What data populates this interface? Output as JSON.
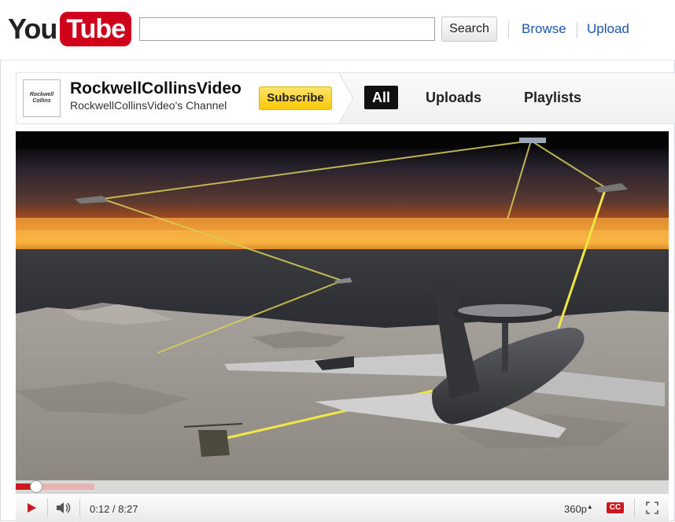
{
  "header": {
    "logo_you": "You",
    "logo_tube": "Tube",
    "search_value": "",
    "search_button": "Search",
    "nav": [
      "Browse",
      "Upload"
    ]
  },
  "channel": {
    "avatar_text": "Rockwell Collins",
    "name": "RockwellCollinsVideo",
    "subtitle": "RockwellCollinsVideo's Channel",
    "subscribe_label": "Subscribe",
    "tabs": [
      {
        "label": "All",
        "active": true
      },
      {
        "label": "Uploads",
        "active": false
      },
      {
        "label": "Playlists",
        "active": false
      }
    ]
  },
  "player": {
    "current_time": "0:12",
    "separator": " / ",
    "duration": "8:27",
    "time_display": "0:12 / 8:27",
    "progress_fraction": 0.024,
    "quality": "360p",
    "cc_label": "CC",
    "icons": [
      "play-icon",
      "volume-icon",
      "quality-arrow-icon",
      "cc-icon",
      "fullscreen-icon"
    ]
  },
  "colors": {
    "brand_red": "#d0021b",
    "link_blue": "#1a56b0",
    "subscribe_yellow": "#fcc807",
    "progress_red": "#cc181e"
  }
}
